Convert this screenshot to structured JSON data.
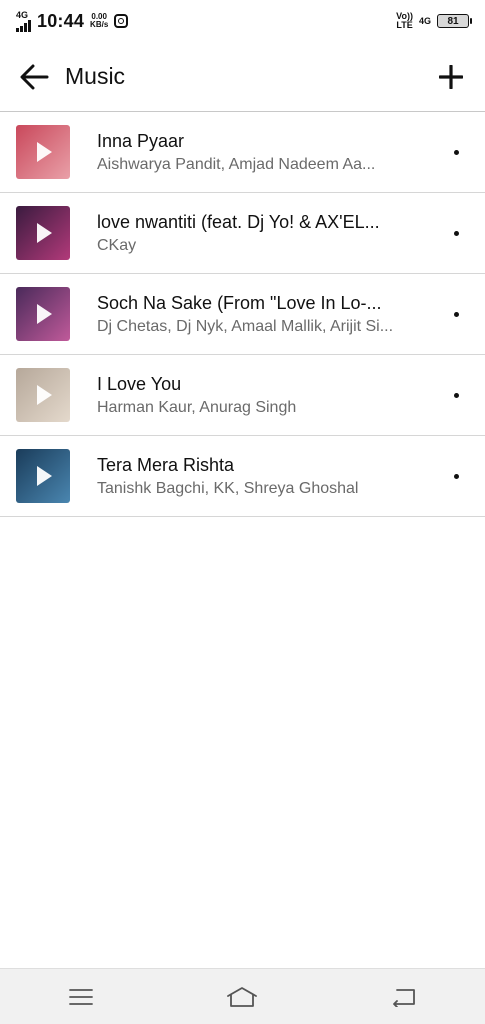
{
  "status_bar": {
    "network_left": "4G",
    "time": "10:44",
    "speed_value": "0.00",
    "speed_unit": "KB/s",
    "volte_top": "Vo))",
    "volte_bottom": "LTE",
    "network_right": "4G",
    "battery_level": "81"
  },
  "header": {
    "title": "Music",
    "back_icon": "arrow-left-icon",
    "add_icon": "plus-icon"
  },
  "tracks": [
    {
      "title": "Inna Pyaar",
      "artist": "Aishwarya Pandit, Amjad Nadeem Aa...",
      "thumb_colors": [
        "#c9485b",
        "#e9a0a8"
      ]
    },
    {
      "title": "love nwantiti (feat. Dj Yo! & AX'EL...",
      "artist": "CKay",
      "thumb_colors": [
        "#3a1b3f",
        "#b23a7a"
      ]
    },
    {
      "title": "Soch Na Sake (From \"Love In Lo-...",
      "artist": "Dj Chetas, Dj Nyk, Amaal Mallik, Arijit Si...",
      "thumb_colors": [
        "#4a2a5a",
        "#c05a9a"
      ]
    },
    {
      "title": "I Love You",
      "artist": "Harman Kaur, Anurag Singh",
      "thumb_colors": [
        "#b6a89a",
        "#e4d9cc"
      ]
    },
    {
      "title": "Tera Mera Rishta",
      "artist": "Tanishk Bagchi, KK, Shreya Ghoshal",
      "thumb_colors": [
        "#1a3c5a",
        "#4a86b0"
      ]
    }
  ],
  "nav_bar": {
    "menu_icon": "menu-icon",
    "home_icon": "home-icon",
    "back_icon": "back-icon"
  }
}
